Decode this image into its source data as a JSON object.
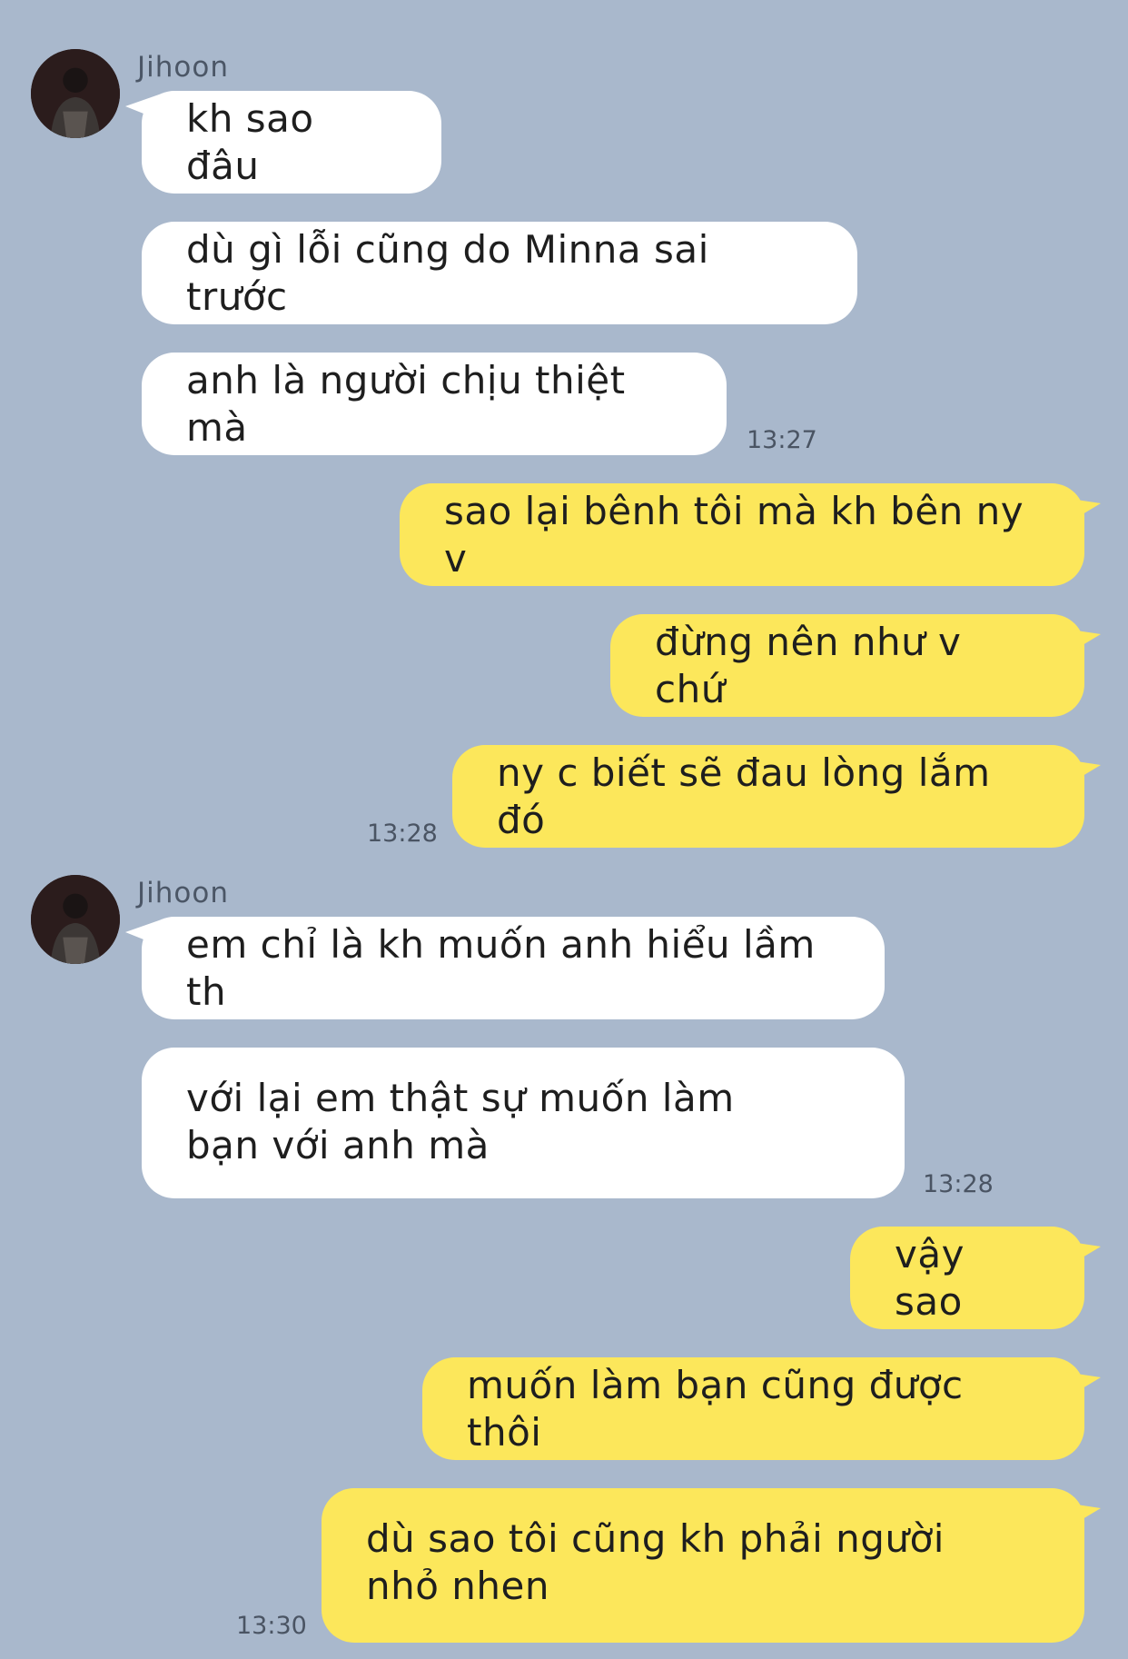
{
  "theme": {
    "background": "#a9b8cc",
    "incoming_bubble": "#ffffff",
    "outgoing_bubble": "#fce75b"
  },
  "contact": {
    "name": "Jihoon",
    "avatar": "profile-photo"
  },
  "messages": [
    {
      "dir": "in",
      "text": "kh sao đâu"
    },
    {
      "dir": "in",
      "text": "dù gì lỗi cũng do Minna sai trước"
    },
    {
      "dir": "in",
      "text": "anh là người chịu thiệt mà",
      "time": "13:27"
    },
    {
      "dir": "out",
      "text": "sao lại bênh tôi mà kh bên ny v"
    },
    {
      "dir": "out",
      "text": "đừng nên như v chứ"
    },
    {
      "dir": "out",
      "text": "ny c biết sẽ đau lòng lắm đó",
      "time": "13:28"
    },
    {
      "dir": "in",
      "text": "em chỉ là kh muốn anh hiểu lầm th"
    },
    {
      "dir": "in",
      "text": "với lại em thật sự muốn làm bạn với anh mà",
      "time": "13:28"
    },
    {
      "dir": "out",
      "text": "vậy sao"
    },
    {
      "dir": "out",
      "text": "muốn làm bạn cũng được thôi"
    },
    {
      "dir": "out",
      "text": "dù sao tôi cũng kh phải người nhỏ nhen",
      "time": "13:30"
    }
  ]
}
